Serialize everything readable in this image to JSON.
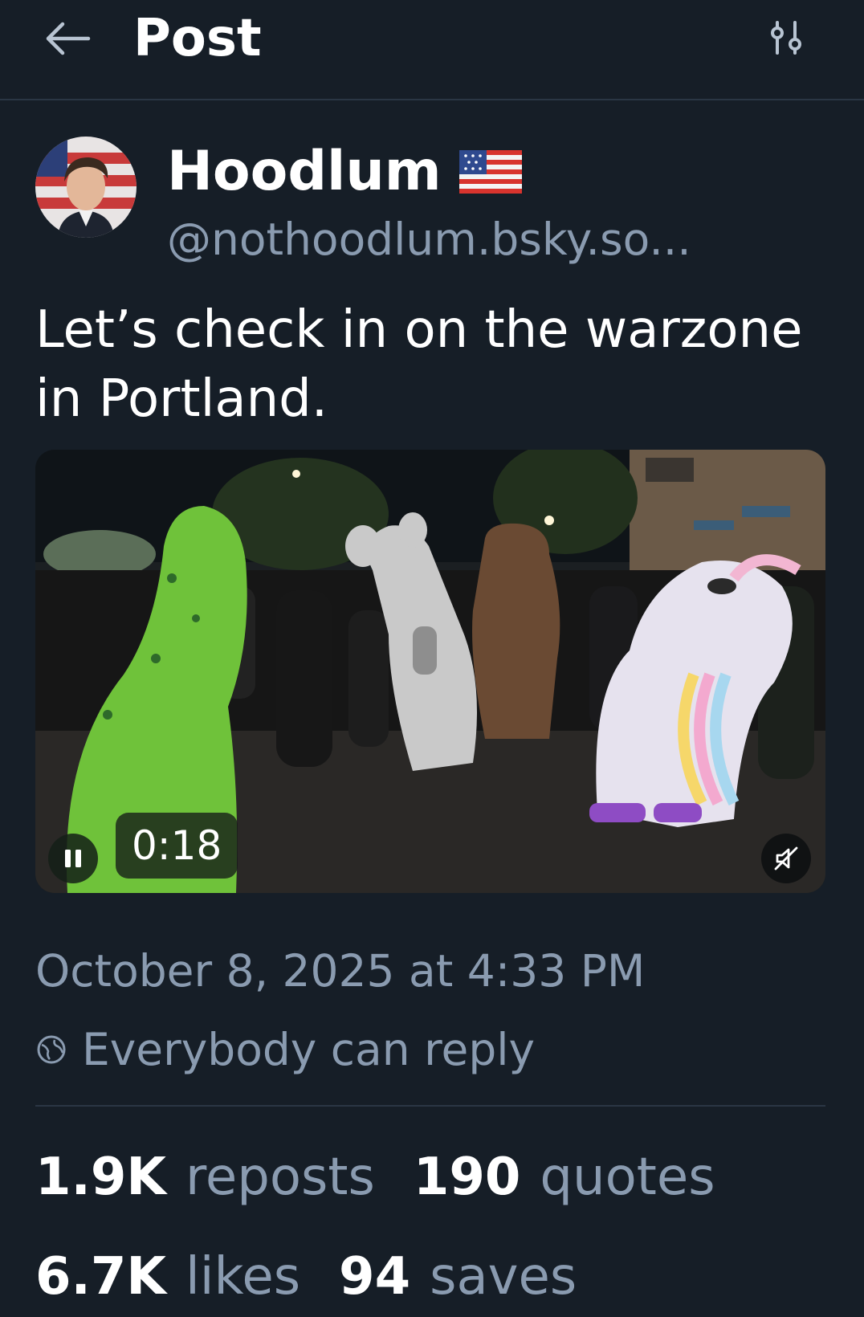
{
  "header": {
    "title": "Post",
    "back_icon": "arrow-left-icon",
    "filter_icon": "sliders-icon"
  },
  "author": {
    "display_name": "Hoodlum",
    "flag_emoji": "us-flag-icon",
    "handle": "@nothoodlum.bsky.so..."
  },
  "post": {
    "text": "Let’s check in on the warzone in Portland."
  },
  "video": {
    "duration": "0:18",
    "pause_icon": "pause-icon",
    "mute_icon": "speaker-muted-icon"
  },
  "meta": {
    "timestamp": "October 8, 2025 at 4:33 PM",
    "reply_setting": "Everybody can reply",
    "reply_icon": "globe-icon"
  },
  "stats": {
    "reposts_count": "1.9K",
    "reposts_label": "reposts",
    "quotes_count": "190",
    "quotes_label": "quotes",
    "likes_count": "6.7K",
    "likes_label": "likes",
    "saves_count": "94",
    "saves_label": "saves"
  },
  "colors": {
    "background": "#161e27",
    "text_primary": "#ffffff",
    "text_secondary": "#8a9bb0",
    "divider": "#2a3644"
  }
}
